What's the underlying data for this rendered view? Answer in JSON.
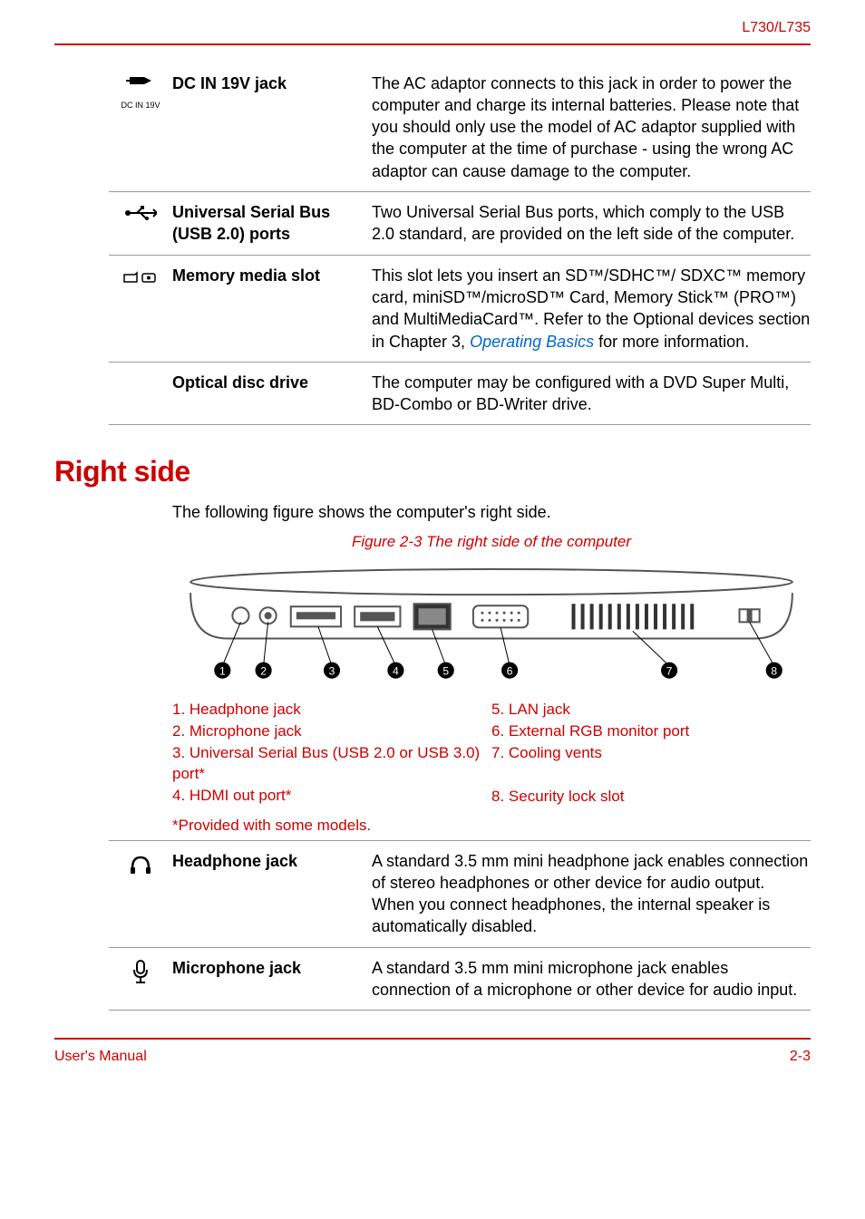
{
  "header": {
    "model": "L730/L735"
  },
  "topTable": {
    "rows": [
      {
        "iconMain": "⎓",
        "iconSub": "DC IN 19V",
        "term": "DC IN 19V jack",
        "desc": "The AC adaptor connects to this jack in order to power the computer and charge its internal batteries. Please note that you should only use the model of AC adaptor supplied with the computer at the time of purchase - using the wrong AC adaptor can cause damage to the computer."
      },
      {
        "iconMain": "⇔",
        "iconSub": "",
        "term": "Universal Serial Bus (USB 2.0) ports",
        "desc": "Two Universal Serial Bus ports, which comply to the USB 2.0 standard, are provided on the left side of the computer."
      },
      {
        "iconMain": "⎙",
        "iconSub": "",
        "term": "Memory media slot",
        "descPre": "This slot lets you insert an SD™/SDHC™/ SDXC™ memory card, miniSD™/microSD™ Card, Memory Stick™ (PRO™) and MultiMediaCard™. Refer to the Optional devices section in Chapter 3, ",
        "link": "Operating Basics",
        "descPost": " for more information."
      },
      {
        "iconMain": "",
        "iconSub": "",
        "term": "Optical disc drive",
        "desc": "The computer may be configured with a DVD Super Multi, BD-Combo or BD-Writer drive."
      }
    ]
  },
  "section": {
    "title": "Right side",
    "intro": "The following figure shows the computer's right side.",
    "figCaption": "Figure 2-3 The right side of the computer"
  },
  "callouts": {
    "left": [
      "1. Headphone jack",
      "2. Microphone jack",
      "3. Universal Serial Bus (USB 2.0 or USB 3.0) port*",
      "4. HDMI out port*"
    ],
    "right": [
      "5. LAN jack",
      "6. External RGB monitor port",
      "7. Cooling vents",
      "8. Security lock slot"
    ],
    "footnote": "*Provided with some models."
  },
  "bottomTable": {
    "rows": [
      {
        "iconMain": "🎧",
        "term": "Headphone jack",
        "desc": "A standard 3.5 mm mini headphone jack enables connection of stereo headphones or other device for audio output. When you connect headphones, the internal speaker is automatically disabled."
      },
      {
        "iconMain": "🎤",
        "term": "Microphone jack",
        "desc": "A standard 3.5 mm mini microphone jack enables connection of a microphone or other device for audio input."
      }
    ]
  },
  "footer": {
    "left": "User's Manual",
    "right": "2-3"
  }
}
